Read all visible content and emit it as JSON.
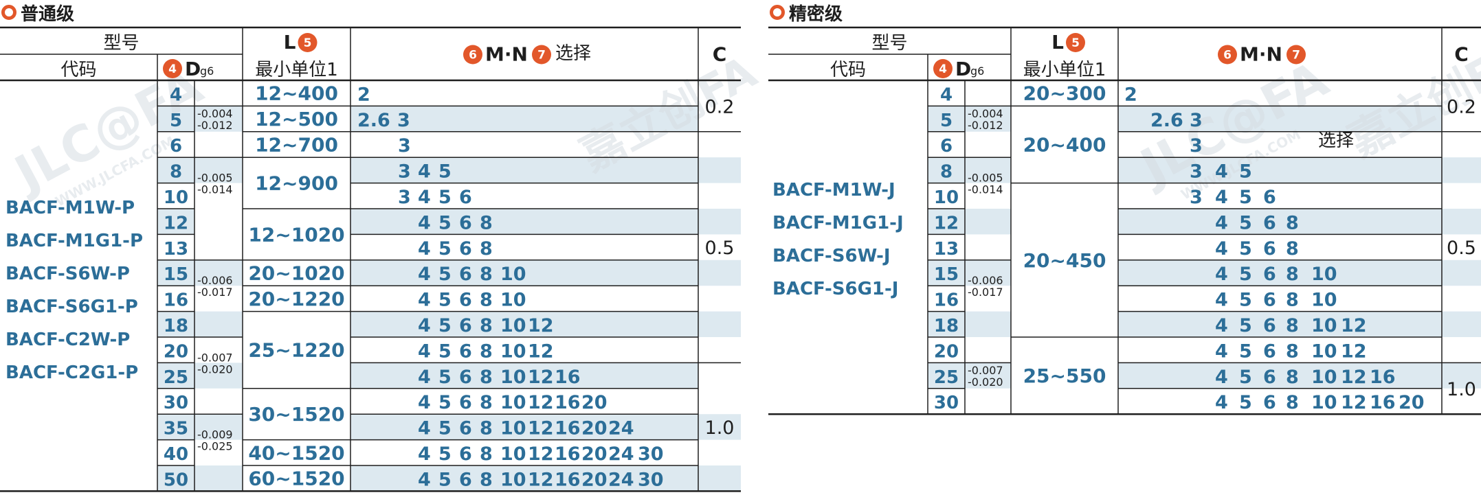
{
  "colors": {
    "accent": "#e2572a",
    "value_blue": "#2c6e98",
    "stripe": "#dde9f0",
    "line": "#1e1e1e"
  },
  "watermark": {
    "text": "嘉立创FA",
    "brand": "JLC@FA",
    "url": "WWW.JLCFA.COM"
  },
  "panels": [
    {
      "title": "普通级",
      "headers": {
        "model": "型号",
        "code": "代码",
        "d_badge": "4",
        "d": "D",
        "d_sub": "g6",
        "l": "L",
        "l_badge": "5",
        "l_sub": "最小单位1",
        "mn_badge1": "6",
        "mn_text": "M·N",
        "mn_badge2": "7",
        "mn_select": "选择",
        "c": "C"
      },
      "models": [
        "BACF-M1W-P",
        "BACF-M1G1-P",
        "BACF-S6W-P",
        "BACF-S6G1-P",
        "BACF-C2W-P",
        "BACF-C2G1-P"
      ],
      "d_values": [
        "4",
        "5",
        "6",
        "8",
        "10",
        "12",
        "13",
        "15",
        "16",
        "18",
        "20",
        "25",
        "30",
        "35",
        "40",
        "50"
      ],
      "tolerances": [
        [
          "-0.004",
          "-0.012"
        ],
        [
          "-0.005",
          "-0.014"
        ],
        [
          "-0.006",
          "-0.017"
        ],
        [
          "-0.007",
          "-0.020"
        ],
        [
          "-0.009",
          "-0.025"
        ]
      ],
      "l_ranges": [
        "12~400",
        "12~500",
        "12~700",
        "12~900",
        "12~1020",
        "20~1020",
        "20~1220",
        "25~1220",
        "30~1520",
        "40~1520",
        "60~1520"
      ],
      "mn_rows": [
        [
          "2"
        ],
        [
          "2.6",
          "3"
        ],
        [
          "3"
        ],
        [
          "3",
          "4",
          "5"
        ],
        [
          "3",
          "4",
          "5",
          "6"
        ],
        [
          "4",
          "5",
          "6",
          "8"
        ],
        [
          "4",
          "5",
          "6",
          "8"
        ],
        [
          "4",
          "5",
          "6",
          "8",
          "10"
        ],
        [
          "4",
          "5",
          "6",
          "8",
          "10"
        ],
        [
          "4",
          "5",
          "6",
          "8",
          "10",
          "12"
        ],
        [
          "4",
          "5",
          "6",
          "8",
          "10",
          "12"
        ],
        [
          "4",
          "5",
          "6",
          "8",
          "10",
          "12",
          "16"
        ],
        [
          "4",
          "5",
          "6",
          "8",
          "10",
          "12",
          "16",
          "20"
        ],
        [
          "4",
          "5",
          "6",
          "8",
          "10",
          "12",
          "16",
          "20",
          "24"
        ],
        [
          "4",
          "5",
          "6",
          "8",
          "10",
          "12",
          "16",
          "20",
          "24",
          "30"
        ],
        [
          "4",
          "5",
          "6",
          "8",
          "10",
          "12",
          "16",
          "20",
          "24",
          "30"
        ]
      ],
      "c_values": [
        "0.2",
        "0.5",
        "1.0"
      ]
    },
    {
      "title": "精密级",
      "headers": {
        "model": "型号",
        "code": "代码",
        "d_badge": "4",
        "d": "D",
        "d_sub": "g6",
        "l": "L",
        "l_badge": "5",
        "l_sub": "最小单位1",
        "mn_badge1": "6",
        "mn_text": "M·N",
        "mn_badge2": "7",
        "mn_select": "选择",
        "c": "C"
      },
      "models": [
        "BACF-M1W-J",
        "BACF-M1G1-J",
        "BACF-S6W-J",
        "BACF-S6G1-J"
      ],
      "d_values": [
        "4",
        "5",
        "6",
        "8",
        "10",
        "12",
        "13",
        "15",
        "16",
        "18",
        "20",
        "25",
        "30"
      ],
      "tolerances": [
        [
          "-0.004",
          "-0.012"
        ],
        [
          "-0.005",
          "-0.014"
        ],
        [
          "-0.006",
          "-0.017"
        ],
        [
          "-0.007",
          "-0.020"
        ]
      ],
      "l_ranges": [
        "20~300",
        "20~400",
        "20~450",
        "25~550"
      ],
      "mn_rows": [
        [
          "2"
        ],
        [
          "2.6",
          "3"
        ],
        [
          "3"
        ],
        [
          "3",
          "4",
          "5"
        ],
        [
          "3",
          "4",
          "5",
          "6"
        ],
        [
          "4",
          "5",
          "6",
          "8"
        ],
        [
          "4",
          "5",
          "6",
          "8"
        ],
        [
          "4",
          "5",
          "6",
          "8",
          "10"
        ],
        [
          "4",
          "5",
          "6",
          "8",
          "10"
        ],
        [
          "4",
          "5",
          "6",
          "8",
          "10",
          "12"
        ],
        [
          "4",
          "5",
          "6",
          "8",
          "10",
          "12"
        ],
        [
          "4",
          "5",
          "6",
          "8",
          "10",
          "12",
          "16"
        ],
        [
          "4",
          "5",
          "6",
          "8",
          "10",
          "12",
          "16",
          "20"
        ]
      ],
      "c_values": [
        "0.2",
        "0.5",
        "1.0"
      ]
    }
  ]
}
